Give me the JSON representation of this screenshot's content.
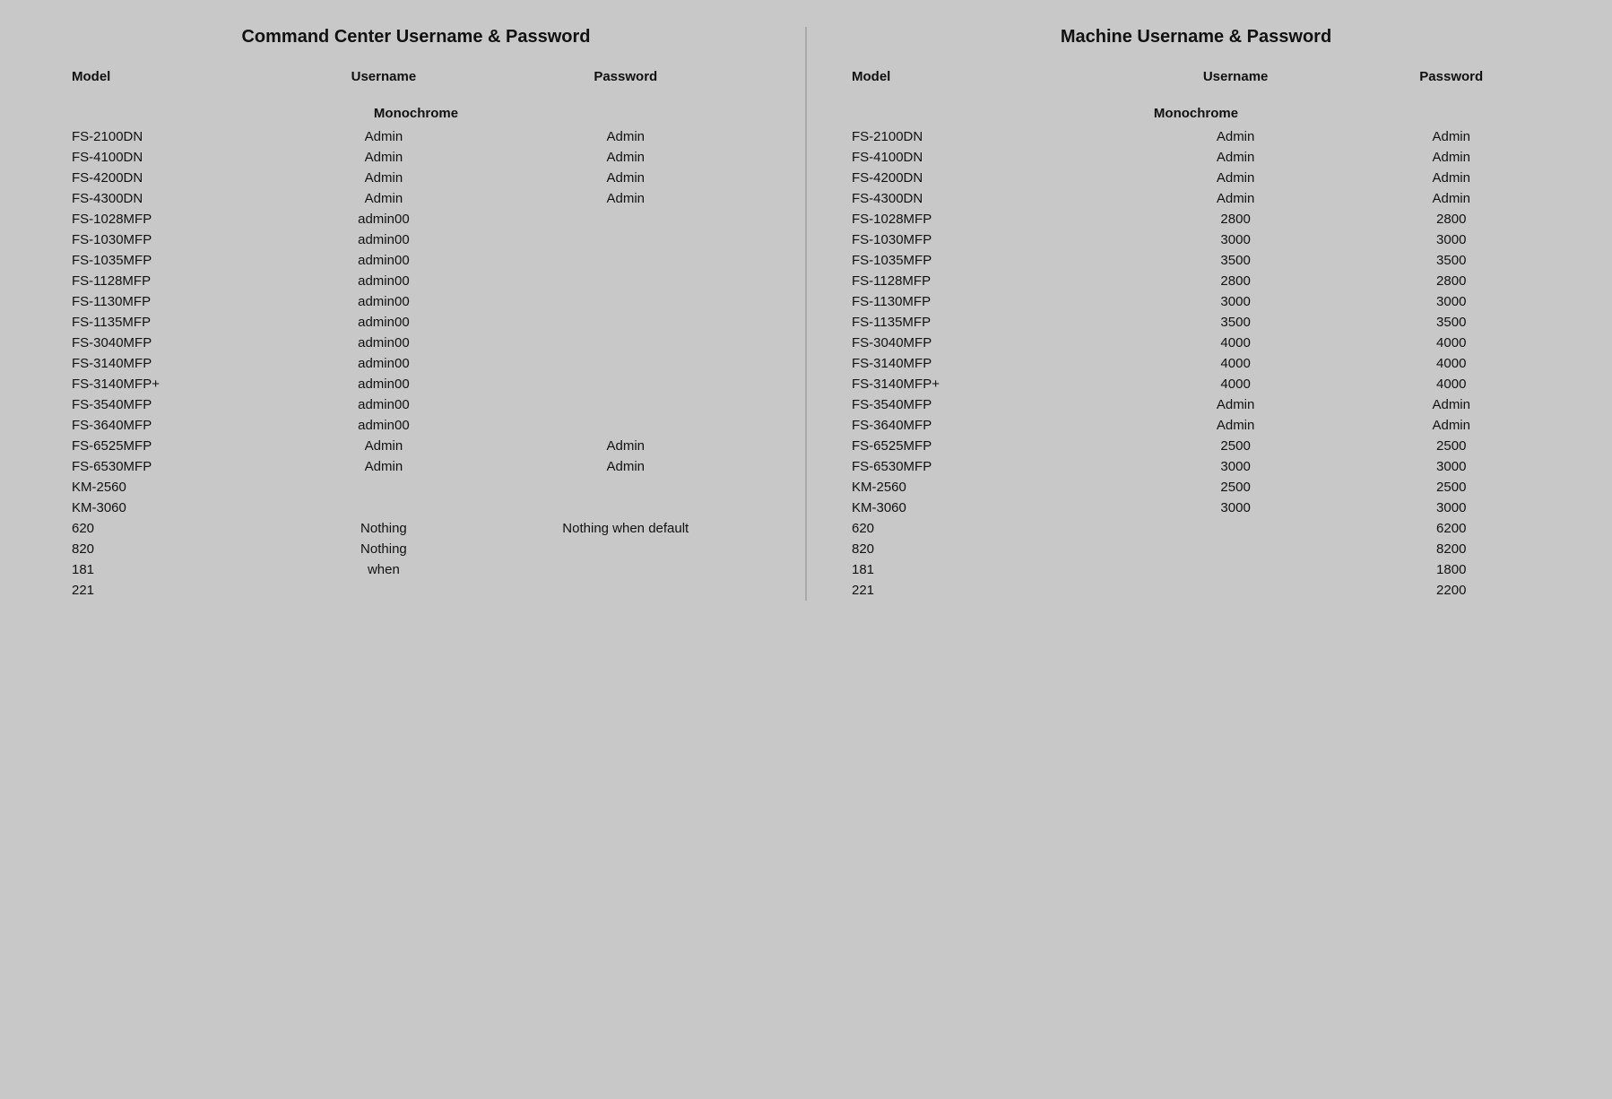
{
  "left_section": {
    "title": "Command Center Username & Password",
    "columns": [
      "Model",
      "Username",
      "Password"
    ],
    "categories": [
      {
        "name": "Monochrome",
        "rows": [
          {
            "model": "FS-2100DN",
            "username": "Admin",
            "password": "Admin"
          },
          {
            "model": "FS-4100DN",
            "username": "Admin",
            "password": "Admin"
          },
          {
            "model": "FS-4200DN",
            "username": "Admin",
            "password": "Admin"
          },
          {
            "model": "FS-4300DN",
            "username": "Admin",
            "password": "Admin"
          },
          {
            "model": "FS-1028MFP",
            "username": "admin00",
            "password": ""
          },
          {
            "model": "FS-1030MFP",
            "username": "admin00",
            "password": ""
          },
          {
            "model": "FS-1035MFP",
            "username": "admin00",
            "password": ""
          },
          {
            "model": "FS-1128MFP",
            "username": "admin00",
            "password": ""
          },
          {
            "model": "FS-1130MFP",
            "username": "admin00",
            "password": ""
          },
          {
            "model": "FS-1135MFP",
            "username": "admin00",
            "password": ""
          },
          {
            "model": "FS-3040MFP",
            "username": "admin00",
            "password": ""
          },
          {
            "model": "FS-3140MFP",
            "username": "admin00",
            "password": ""
          },
          {
            "model": "FS-3140MFP+",
            "username": "admin00",
            "password": ""
          },
          {
            "model": "FS-3540MFP",
            "username": "admin00",
            "password": ""
          },
          {
            "model": "FS-3640MFP",
            "username": "admin00",
            "password": ""
          },
          {
            "model": "FS-6525MFP",
            "username": "Admin",
            "password": "Admin"
          },
          {
            "model": "FS-6530MFP",
            "username": "Admin",
            "password": "Admin"
          },
          {
            "model": "KM-2560",
            "username": "",
            "password": ""
          },
          {
            "model": "KM-3060",
            "username": "",
            "password": ""
          },
          {
            "model": "620",
            "username": "Nothing",
            "password": "Nothing when default"
          },
          {
            "model": "820",
            "username": "Nothing",
            "password": ""
          },
          {
            "model": "181",
            "username": "when",
            "password": ""
          },
          {
            "model": "221",
            "username": "",
            "password": ""
          }
        ]
      }
    ]
  },
  "right_section": {
    "title": "Machine Username & Password",
    "columns": [
      "Model",
      "Username",
      "Password"
    ],
    "categories": [
      {
        "name": "Monochrome",
        "rows": [
          {
            "model": "FS-2100DN",
            "username": "Admin",
            "password": "Admin"
          },
          {
            "model": "FS-4100DN",
            "username": "Admin",
            "password": "Admin"
          },
          {
            "model": "FS-4200DN",
            "username": "Admin",
            "password": "Admin"
          },
          {
            "model": "FS-4300DN",
            "username": "Admin",
            "password": "Admin"
          },
          {
            "model": "FS-1028MFP",
            "username": "2800",
            "password": "2800"
          },
          {
            "model": "FS-1030MFP",
            "username": "3000",
            "password": "3000"
          },
          {
            "model": "FS-1035MFP",
            "username": "3500",
            "password": "3500"
          },
          {
            "model": "FS-1128MFP",
            "username": "2800",
            "password": "2800"
          },
          {
            "model": "FS-1130MFP",
            "username": "3000",
            "password": "3000"
          },
          {
            "model": "FS-1135MFP",
            "username": "3500",
            "password": "3500"
          },
          {
            "model": "FS-3040MFP",
            "username": "4000",
            "password": "4000"
          },
          {
            "model": "FS-3140MFP",
            "username": "4000",
            "password": "4000"
          },
          {
            "model": "FS-3140MFP+",
            "username": "4000",
            "password": "4000"
          },
          {
            "model": "FS-3540MFP",
            "username": "Admin",
            "password": "Admin"
          },
          {
            "model": "FS-3640MFP",
            "username": "Admin",
            "password": "Admin"
          },
          {
            "model": "FS-6525MFP",
            "username": "2500",
            "password": "2500"
          },
          {
            "model": "FS-6530MFP",
            "username": "3000",
            "password": "3000"
          },
          {
            "model": "KM-2560",
            "username": "2500",
            "password": "2500"
          },
          {
            "model": "KM-3060",
            "username": "3000",
            "password": "3000"
          },
          {
            "model": "620",
            "username": "",
            "password": "6200"
          },
          {
            "model": "820",
            "username": "",
            "password": "8200"
          },
          {
            "model": "181",
            "username": "",
            "password": "1800"
          },
          {
            "model": "221",
            "username": "",
            "password": "2200"
          }
        ]
      }
    ]
  }
}
